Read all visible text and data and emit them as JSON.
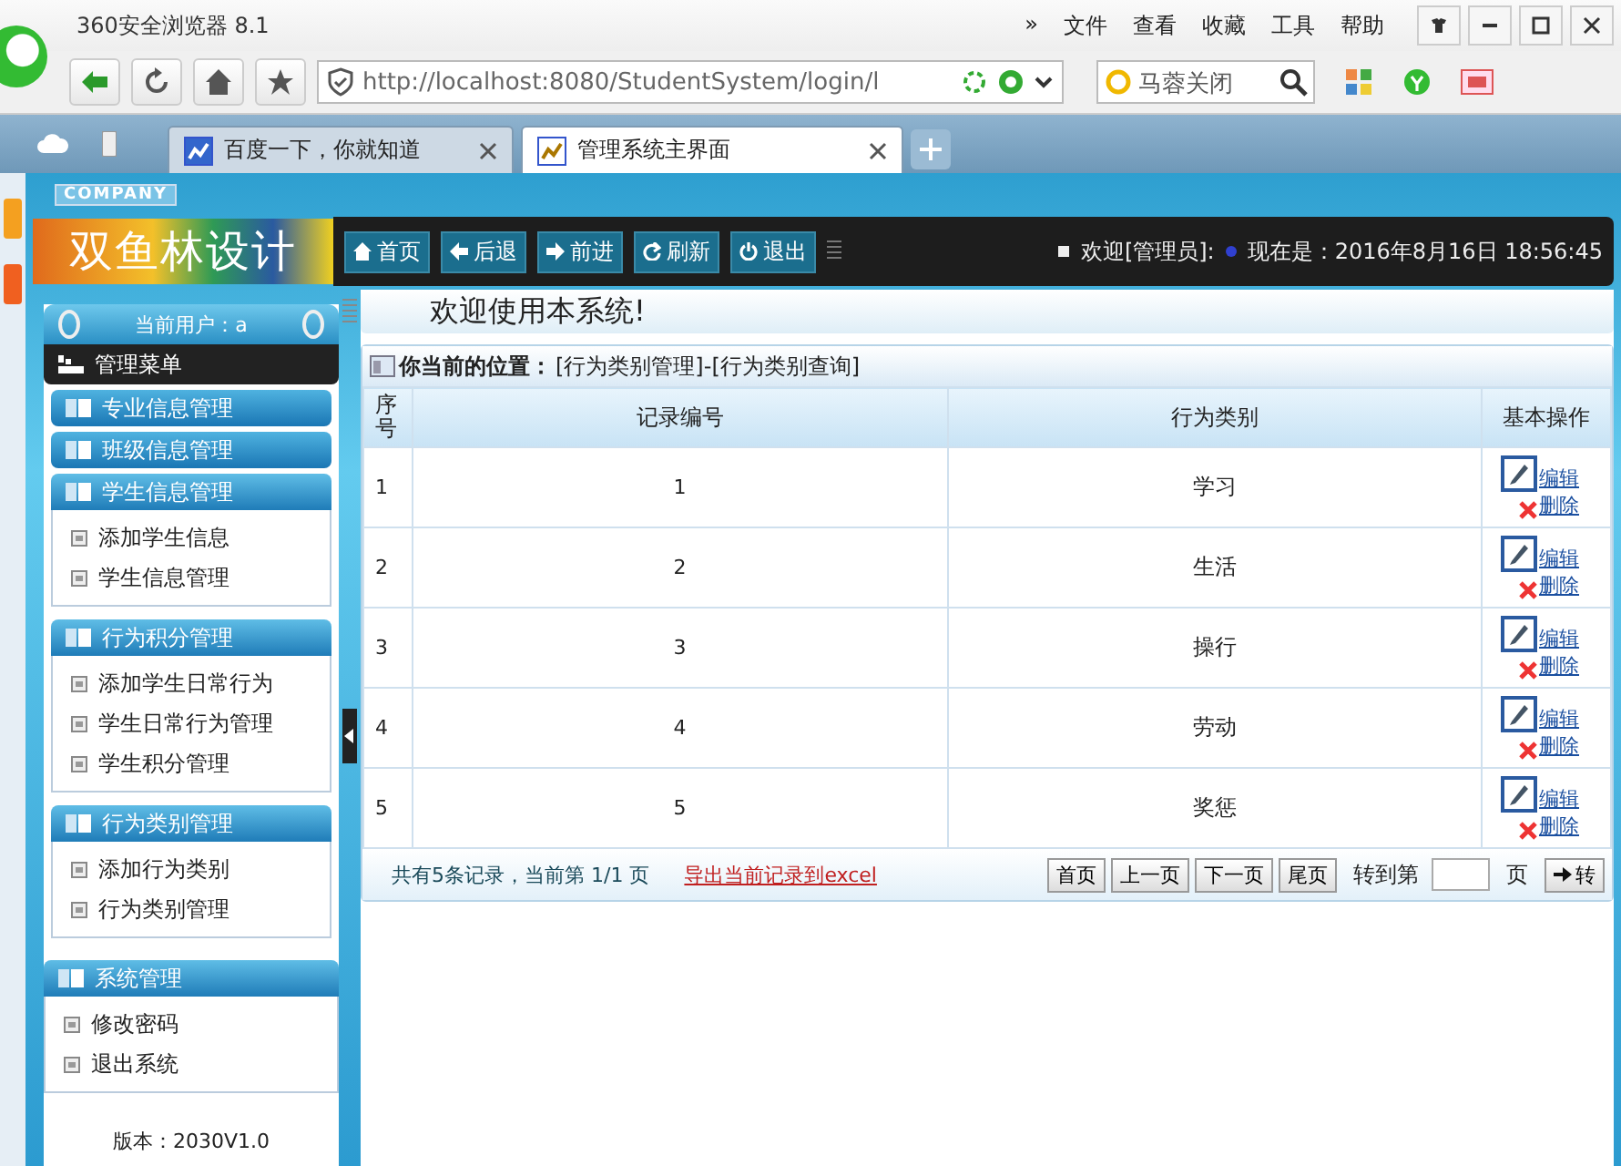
{
  "browser": {
    "title": "360安全浏览器 8.1",
    "menu": [
      "»",
      "文件",
      "查看",
      "收藏",
      "工具",
      "帮助"
    ],
    "address": "http://localhost:8080/StudentSystem/login/l",
    "search": {
      "placeholder": "马蓉关闭"
    },
    "tabs": [
      {
        "label": "百度一下，你就知道",
        "selected": false
      },
      {
        "label": "管理系统主界面",
        "selected": true
      }
    ]
  },
  "header": {
    "company": "COMPANY",
    "logo": "双鱼林设计",
    "nav": [
      {
        "kind": "home",
        "label": "首页"
      },
      {
        "kind": "back",
        "label": "后退"
      },
      {
        "kind": "forward",
        "label": "前进"
      },
      {
        "kind": "refresh",
        "label": "刷新"
      },
      {
        "kind": "power",
        "label": "退出"
      }
    ],
    "welcome": "欢迎[管理员]:",
    "clock": "现在是：2016年8月16日 18:56:45"
  },
  "sidebar": {
    "user": "当前用户：a",
    "menu_title": "管理菜单",
    "groups": [
      {
        "title": "专业信息管理",
        "expanded": false
      },
      {
        "title": "班级信息管理",
        "expanded": false
      },
      {
        "title": "学生信息管理",
        "expanded": true,
        "items": [
          "添加学生信息",
          "学生信息管理"
        ]
      },
      {
        "title": "行为积分管理",
        "expanded": true,
        "items": [
          "添加学生日常行为",
          "学生日常行为管理",
          "学生积分管理"
        ]
      },
      {
        "title": "行为类别管理",
        "expanded": true,
        "items": [
          "添加行为类别",
          "行为类别管理"
        ]
      },
      {
        "title": "系统管理",
        "expanded": true,
        "items": [
          "修改密码",
          "退出系统"
        ]
      }
    ],
    "version": "版本：2030V1.0"
  },
  "content": {
    "welcome": "欢迎使用本系统!",
    "location_label": "你当前的位置：",
    "location": "[行为类别管理]-[行为类别查询]",
    "columns": [
      "序号",
      "记录编号",
      "行为类别",
      "基本操作"
    ],
    "rows": [
      {
        "index": "1",
        "id": "1",
        "category": "学习",
        "actions": [
          "编辑",
          "删除"
        ]
      },
      {
        "index": "2",
        "id": "2",
        "category": "生活",
        "actions": [
          "编辑",
          "删除"
        ]
      },
      {
        "index": "3",
        "id": "3",
        "category": "操行",
        "actions": [
          "编辑",
          "删除"
        ]
      },
      {
        "index": "4",
        "id": "4",
        "category": "劳动",
        "actions": [
          "编辑",
          "删除"
        ]
      },
      {
        "index": "5",
        "id": "5",
        "category": "奖惩",
        "actions": [
          "编辑",
          "删除"
        ]
      }
    ],
    "footer": {
      "summary": "共有5条记录，当前第 1/1 页",
      "export": "导出当前记录到excel",
      "pager": [
        "首页",
        "上一页",
        "下一页",
        "尾页"
      ],
      "goto_label": "转到第",
      "page_unit": "页",
      "go": "转"
    }
  }
}
